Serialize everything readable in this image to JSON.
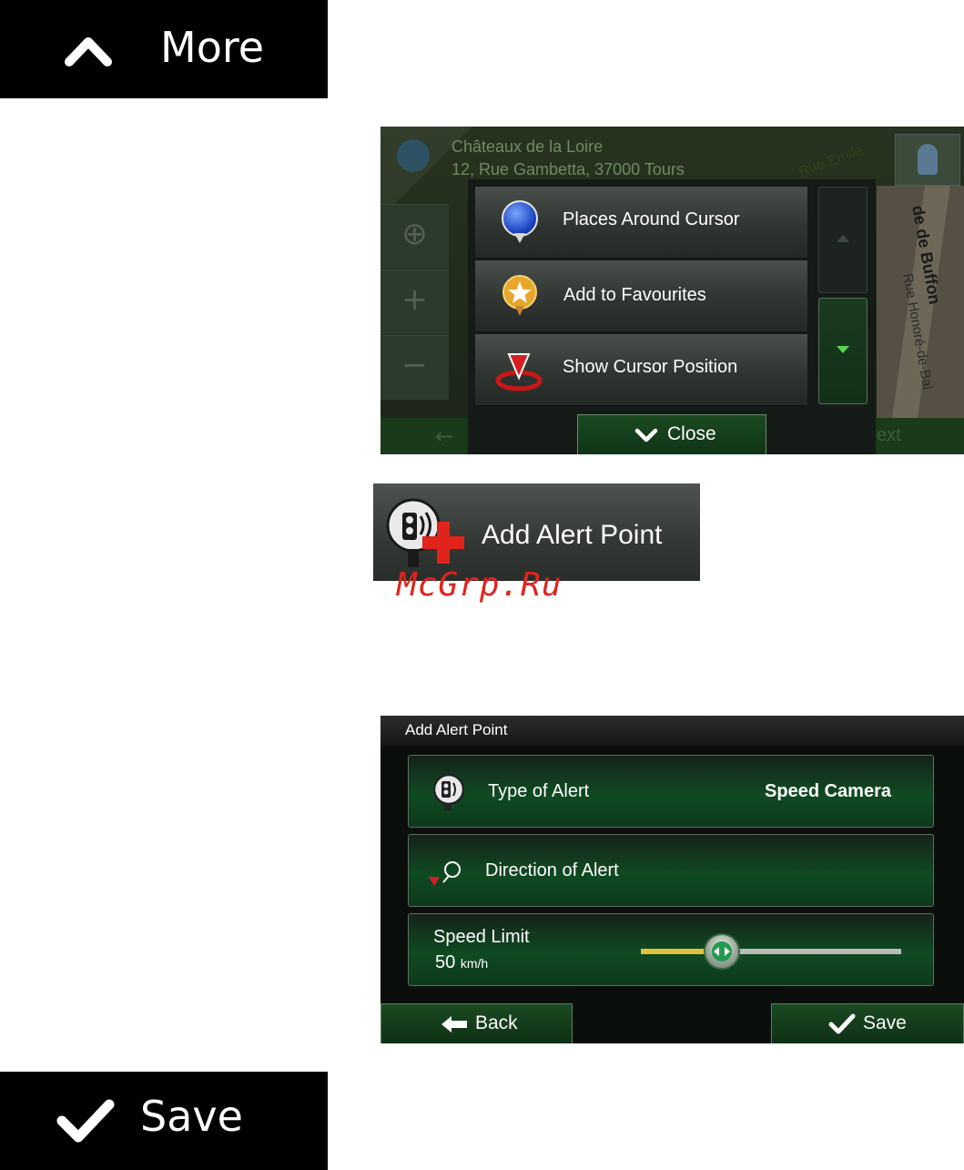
{
  "more_button": {
    "label": "More",
    "icon": "chevron-up-icon"
  },
  "map_screen": {
    "address_line1": "Châteaux de la Loire",
    "address_line2": "12, Rue Gambetta, 37000 Tours",
    "street_labels": [
      "de de Buffon",
      "Rue Honoré-de-Bal",
      "Rue Emile"
    ],
    "bottom_next_fragment": "ext",
    "menu": {
      "items": [
        {
          "label": "Places Around Cursor",
          "icon": "blue-pin-icon"
        },
        {
          "label": "Add to Favourites",
          "icon": "star-pin-icon"
        },
        {
          "label": "Show Cursor Position",
          "icon": "cursor-target-icon"
        }
      ],
      "close_label": "Close"
    }
  },
  "add_alert_button": {
    "label": "Add Alert Point",
    "icon": "speed-camera-add-icon"
  },
  "watermark": "McGrp.Ru",
  "alert_form": {
    "title": "Add Alert Point",
    "type_label": "Type of Alert",
    "type_value": "Speed Camera",
    "direction_label": "Direction of Alert",
    "speed_label": "Speed Limit",
    "speed_value": "50",
    "speed_unit": "km/h",
    "speed_slider_fraction": 0.31,
    "back_label": "Back",
    "save_label": "Save"
  },
  "save_button": {
    "label": "Save",
    "icon": "checkmark-icon"
  },
  "colors": {
    "accent_green": "#0f4a22",
    "slider_yellow": "#e2c23a",
    "red": "#e0241c"
  }
}
